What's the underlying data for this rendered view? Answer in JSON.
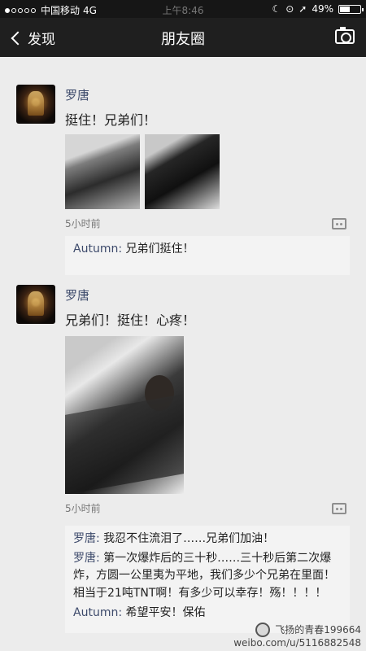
{
  "status_bar": {
    "carrier": "中国移动",
    "network": "4G",
    "time": "上午8:46",
    "battery": "49%"
  },
  "nav": {
    "back": "发现",
    "title": "朋友圈"
  },
  "posts": [
    {
      "author": "罗唐",
      "text": "挺住！兄弟们！",
      "time": "5小时前",
      "comments": [
        {
          "name": "Autumn:",
          "text": " 兄弟们挺住！"
        }
      ]
    },
    {
      "author": "罗唐",
      "text": "兄弟们！挺住！心疼！",
      "time": "5小时前",
      "comments": [
        {
          "name": "罗唐:",
          "text": " 我忍不住流泪了……兄弟们加油！"
        },
        {
          "name": "罗唐:",
          "text": " 第一次爆炸后的三十秒……三十秒后第二次爆炸，方圆一公里夷为平地，我们多少个兄弟在里面！相当于21吨TNT啊！有多少可以幸存！殇！！！！"
        },
        {
          "name": "Autumn:",
          "text": " 希望平安！保佑"
        }
      ]
    }
  ],
  "watermark": {
    "line1": "飞扬的青春199664",
    "line2": "weibo.com/u/5116882548"
  }
}
